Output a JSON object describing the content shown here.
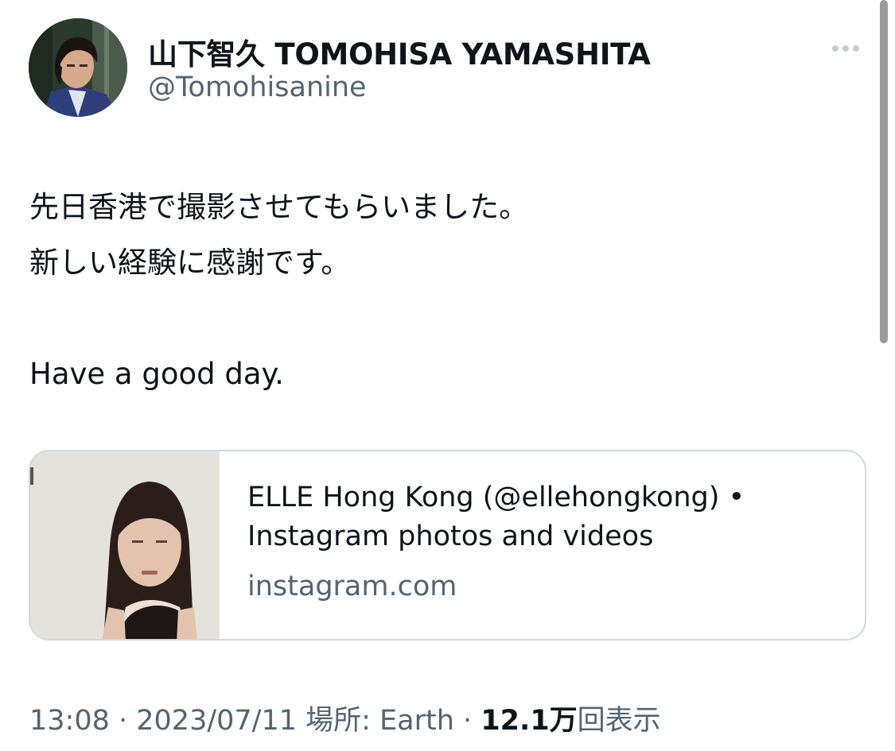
{
  "author": {
    "display_name": "山下智久 TOMOHISA YAMASHITA",
    "handle": "@Tomohisanine"
  },
  "tweet": {
    "lines": [
      "先日香港で撮影させてもらいました。",
      "新しい経験に感謝です。",
      "Have a good day."
    ]
  },
  "link_card": {
    "title": "ELLE Hong Kong (@ellehongkong) • Instagram photos and videos",
    "domain": "instagram.com"
  },
  "meta": {
    "time": "13:08",
    "separator": " · ",
    "date": "2023/07/11",
    "location": "場所: Earth",
    "views_count": "12.1万",
    "views_label": "回表示"
  },
  "icons": {
    "more": "more-horizontal-icon"
  },
  "colors": {
    "primary_text": "#0f1419",
    "secondary_text": "#536471",
    "card_border": "#cfd9de"
  }
}
